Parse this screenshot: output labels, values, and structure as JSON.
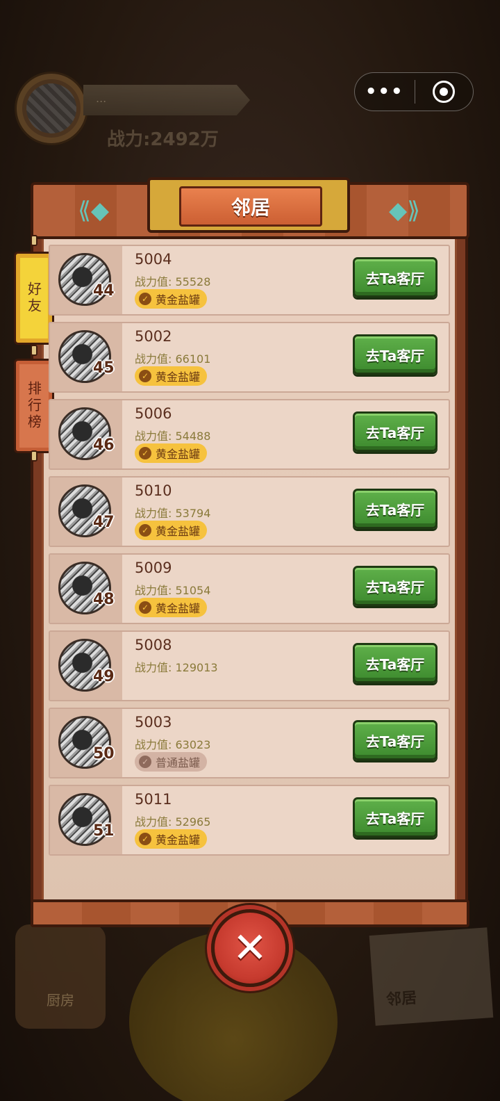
{
  "background": {
    "player_name": "...",
    "player_power": "战力:2492万",
    "bottom_left_label": "厨房",
    "bottom_right_label": "邻居"
  },
  "capsule": {
    "more_icon": "more-dots-icon",
    "close_icon": "target-circle-icon"
  },
  "modal": {
    "title": "邻居",
    "tabs": {
      "friends": "好友",
      "leaderboard": "排行榜"
    },
    "visit_label": "去Ta客厅",
    "close_icon": "close-x-icon"
  },
  "neighbors": [
    {
      "rank": "44",
      "name": "5004",
      "power": "战力值: 55528",
      "badge": "黄金盐罐",
      "badge_type": "gold"
    },
    {
      "rank": "45",
      "name": "5002",
      "power": "战力值: 66101",
      "badge": "黄金盐罐",
      "badge_type": "gold"
    },
    {
      "rank": "46",
      "name": "5006",
      "power": "战力值: 54488",
      "badge": "黄金盐罐",
      "badge_type": "gold"
    },
    {
      "rank": "47",
      "name": "5010",
      "power": "战力值: 53794",
      "badge": "黄金盐罐",
      "badge_type": "gold"
    },
    {
      "rank": "48",
      "name": "5009",
      "power": "战力值: 51054",
      "badge": "黄金盐罐",
      "badge_type": "gold"
    },
    {
      "rank": "49",
      "name": "5008",
      "power": "战力值: 129013",
      "badge": "",
      "badge_type": "none"
    },
    {
      "rank": "50",
      "name": "5003",
      "power": "战力值: 63023",
      "badge": "普通盐罐",
      "badge_type": "normal"
    },
    {
      "rank": "51",
      "name": "5011",
      "power": "战力值: 52965",
      "badge": "黄金盐罐",
      "badge_type": "gold"
    }
  ],
  "colors": {
    "visit_button": "#4a9a38",
    "gold_badge": "#f6c23e",
    "normal_badge": "#d3b3a4",
    "title_plate": "#d96a3c",
    "friends_tab": "#f4d33a"
  }
}
